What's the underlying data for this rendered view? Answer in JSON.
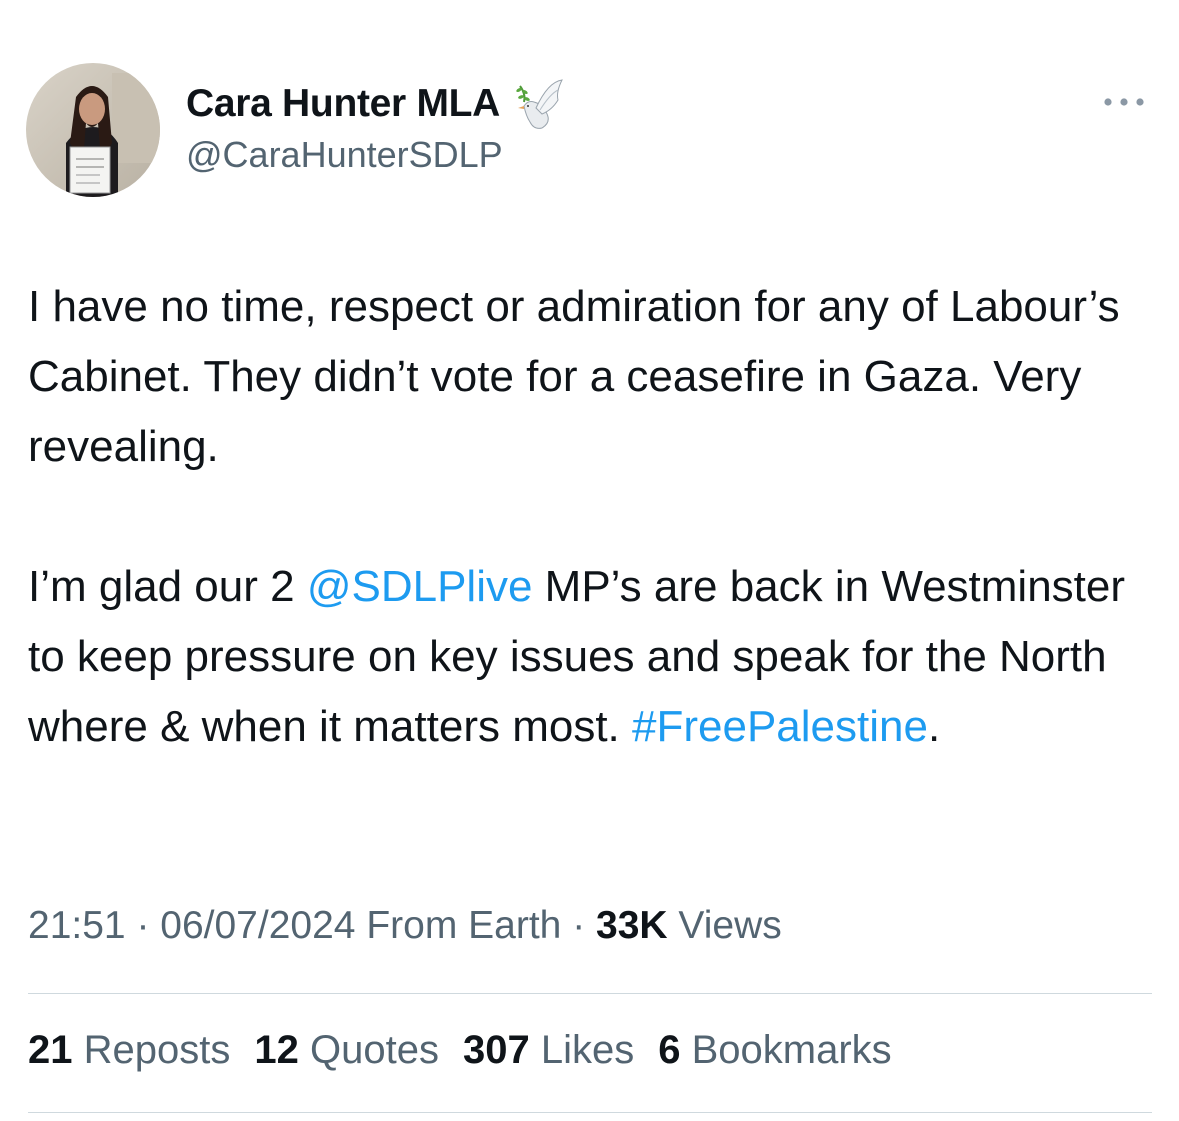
{
  "author": {
    "display_name": "Cara Hunter MLA",
    "handle": "@CaraHunterSDLP",
    "badge_icon": "dove-with-olive-branch-icon"
  },
  "tweet": {
    "paragraph1": "I have no time, respect or admiration for any of Labour’s Cabinet. They didn’t vote for a ceasefire in Gaza. Very revealing.",
    "p2_before": "I’m glad our 2 ",
    "p2_mention": "@SDLPlive",
    "p2_middle": " MP’s are back in Westminster to keep pressure on key issues and speak for the North where & when it matters most. ",
    "p2_hashtag": "#FreePalestine",
    "p2_after": "."
  },
  "meta": {
    "time": "21:51",
    "sep1": " · ",
    "date": "06/07/2024",
    "source": " From Earth",
    "sep2": " · ",
    "views_count": "33K",
    "views_label": " Views"
  },
  "stats": [
    {
      "count": "21",
      "label": "Reposts"
    },
    {
      "count": "12",
      "label": "Quotes"
    },
    {
      "count": "307",
      "label": "Likes"
    },
    {
      "count": "6",
      "label": "Bookmarks"
    }
  ],
  "colors": {
    "link": "#1d9bf0",
    "secondary_text": "#536471",
    "primary_text": "#0f1419",
    "divider": "#cfd9de"
  },
  "icons": {
    "more": "more-horizontal-icon",
    "avatar": "profile-avatar"
  }
}
